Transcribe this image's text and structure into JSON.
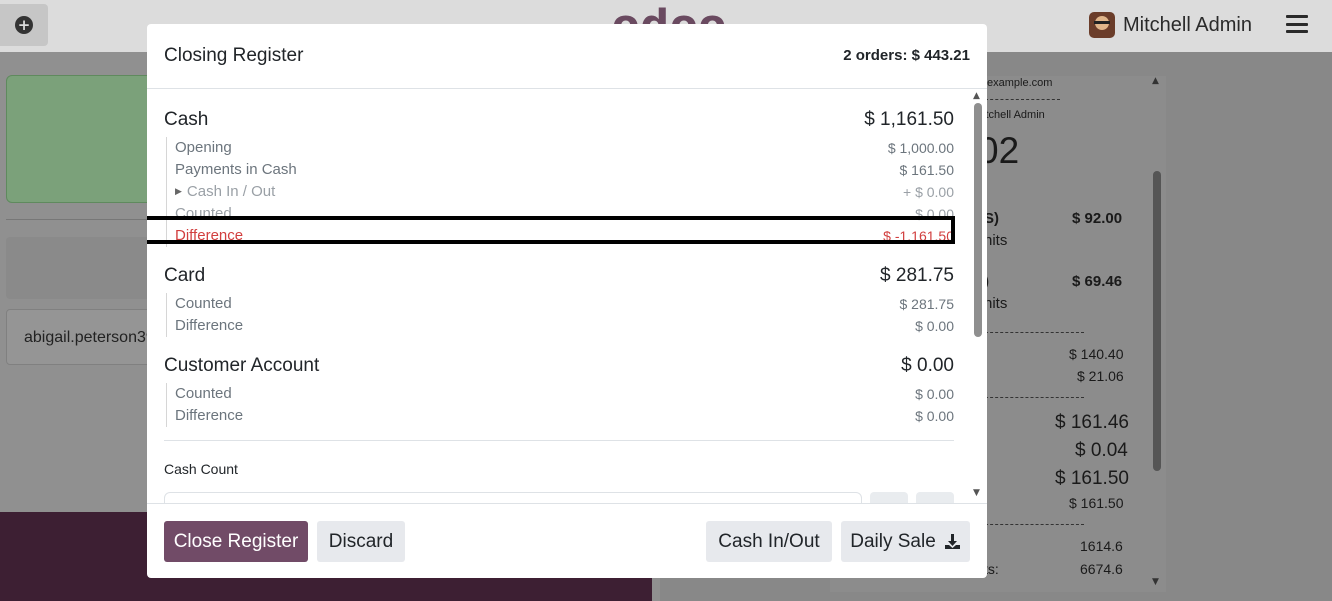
{
  "background": {
    "logo": "odoo",
    "user_name": "Mitchell Admin",
    "customer_email": "abigail.peterson39@",
    "receipt": {
      "email_fragment": "example.com",
      "served_by_fragment": "itchell Admin",
      "order_no_fragment": "02",
      "line1_name": "S)",
      "line1_price": "$ 92.00",
      "line1_qty": "nits",
      "line2_name": ")",
      "line2_price": "$ 69.46",
      "line2_qty": "nits",
      "subtotal": "$ 140.40",
      "tax": "$ 21.06",
      "total": "$ 161.46",
      "rounding": "$ 0.04",
      "total_rounded": "$ 161.50",
      "paid": "$ 161.50",
      "val1": "1614.6",
      "label2": "ts:",
      "val2": "6674.6"
    }
  },
  "modal": {
    "title": "Closing Register",
    "summary": "2 orders: $ 443.21",
    "payment_methods": [
      {
        "name": "Cash",
        "total": "$ 1,161.50",
        "lines": [
          {
            "label": "Opening",
            "value": "$ 1,000.00"
          },
          {
            "label": "Payments in Cash",
            "value": "$ 161.50"
          },
          {
            "label": "Cash In / Out",
            "value": "+ $ 0.00"
          },
          {
            "label": "Counted",
            "value": "$ 0.00"
          },
          {
            "label": "Difference",
            "value": "$ -1,161.50"
          }
        ]
      },
      {
        "name": "Card",
        "total": "$ 281.75",
        "lines": [
          {
            "label": "Counted",
            "value": "$ 281.75"
          },
          {
            "label": "Difference",
            "value": "$ 0.00"
          }
        ]
      },
      {
        "name": "Customer Account",
        "total": "$ 0.00",
        "lines": [
          {
            "label": "Counted",
            "value": "$ 0.00"
          },
          {
            "label": "Difference",
            "value": "$ 0.00"
          }
        ]
      }
    ],
    "cash_count_label": "Cash Count",
    "buttons": {
      "close_register": "Close Register",
      "discard": "Discard",
      "cash_in_out": "Cash In/Out",
      "daily_sale": "Daily Sale"
    }
  },
  "colors": {
    "primary": "#714b67",
    "danger": "#d23f3f",
    "muted_text": "#6c757d"
  }
}
